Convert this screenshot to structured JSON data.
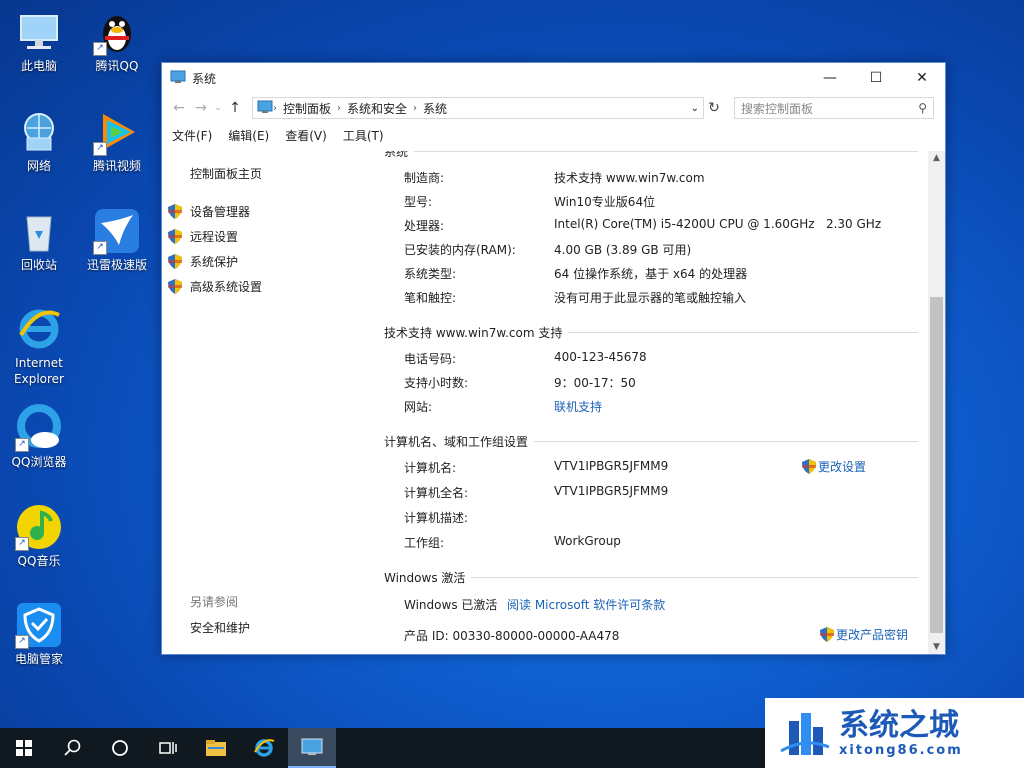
{
  "desktop": {
    "icons": [
      {
        "label": "此电脑",
        "icon": "computer-icon"
      },
      {
        "label": "腾讯QQ",
        "icon": "qq-penguin-icon"
      },
      {
        "label": "网络",
        "icon": "network-icon"
      },
      {
        "label": "腾讯视频",
        "icon": "tencent-video-icon"
      },
      {
        "label": "回收站",
        "icon": "recycle-bin-icon"
      },
      {
        "label": "迅雷极速版",
        "icon": "thunder-icon"
      },
      {
        "label": "Internet Explorer",
        "icon": "ie-icon"
      },
      {
        "label": "QQ浏览器",
        "icon": "qq-browser-icon"
      },
      {
        "label": "QQ音乐",
        "icon": "qq-music-icon"
      },
      {
        "label": "电脑管家",
        "icon": "pc-manager-icon"
      }
    ]
  },
  "window": {
    "title": "系统",
    "breadcrumb": [
      "控制面板",
      "系统和安全",
      "系统"
    ],
    "search_placeholder": "搜索控制面板",
    "menu": [
      "文件(F)",
      "编辑(E)",
      "查看(V)",
      "工具(T)"
    ]
  },
  "left_pane": {
    "home": "控制面板主页",
    "links": [
      "设备管理器",
      "远程设置",
      "系统保护",
      "高级系统设置"
    ],
    "see_also": "另请参阅",
    "security": "安全和维护"
  },
  "system_section": {
    "partial_header": "系统",
    "rows": [
      {
        "label": "制造商:",
        "value": "技术支持 www.win7w.com"
      },
      {
        "label": "型号:",
        "value": "Win10专业版64位"
      },
      {
        "label": "处理器:",
        "value": "Intel(R) Core(TM) i5-4200U CPU @ 1.60GHz   2.30 GHz"
      },
      {
        "label": "已安装的内存(RAM):",
        "value": "4.00 GB (3.89 GB 可用)"
      },
      {
        "label": "系统类型:",
        "value": "64 位操作系统，基于 x64 的处理器"
      },
      {
        "label": "笔和触控:",
        "value": "没有可用于此显示器的笔或触控输入"
      }
    ]
  },
  "support_section": {
    "header": "技术支持 www.win7w.com 支持",
    "rows": [
      {
        "label": "电话号码:",
        "value": "400-123-45678"
      },
      {
        "label": "支持小时数:",
        "value": "9：00-17：50"
      },
      {
        "label": "网站:",
        "value": "联机支持"
      }
    ]
  },
  "computer_section": {
    "header": "计算机名、域和工作组设置",
    "rows": [
      {
        "label": "计算机名:",
        "value": "VTV1IPBGR5JFMM9"
      },
      {
        "label": "计算机全名:",
        "value": "VTV1IPBGR5JFMM9"
      },
      {
        "label": "计算机描述:",
        "value": ""
      },
      {
        "label": "工作组:",
        "value": "WorkGroup"
      }
    ],
    "change_settings": "更改设置"
  },
  "activation_section": {
    "header": "Windows 激活",
    "status": "Windows 已激活",
    "license_link": "阅读 Microsoft 软件许可条款",
    "product_id": "产品 ID: 00330-80000-00000-AA478",
    "change_key": "更改产品密钥"
  },
  "watermark": {
    "title": "系统之城",
    "url": "xitong86.com"
  },
  "colors": {
    "link": "#1a63b8",
    "accent": "#1d5ab8",
    "taskbar": "#101820"
  }
}
